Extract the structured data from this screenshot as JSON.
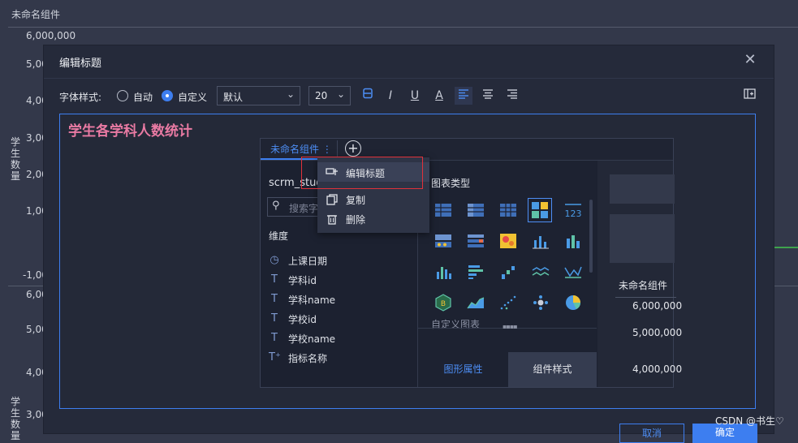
{
  "background": {
    "title": "未命名组件",
    "top_ticks": [
      "6,000,000",
      "5,00",
      "4,00",
      "3,00",
      "2,00",
      "1,00",
      "-1,00"
    ],
    "bottom_ticks": [
      "6,00",
      "5,00",
      "4,00",
      "3,00"
    ],
    "y_label_chars": [
      "学",
      "生",
      "数",
      "量"
    ]
  },
  "dialog": {
    "title": "编辑标题",
    "close_icon": "close-icon",
    "toolbar": {
      "font_style_label": "字体样式:",
      "radio_auto": "自动",
      "radio_custom": "自定义",
      "font_family_value": "默认",
      "font_size_value": "20",
      "icons": [
        "bold-icon",
        "italic-icon",
        "underline-icon",
        "font-color-icon",
        "align-left-icon",
        "align-center-icon",
        "align-right-icon",
        "insert-icon"
      ]
    },
    "heading_text": "学生各学科人数统计",
    "cancel_label": "取消",
    "confirm_label": "确定"
  },
  "inner": {
    "tab_label": "未命名组件",
    "dataset_name": "scrm_study",
    "search_placeholder": "搜索字",
    "dimension_label": "维度",
    "fields": [
      {
        "icon": "clock-icon",
        "glyph": "◷",
        "label": "上课日期"
      },
      {
        "icon": "text-type-icon",
        "glyph": "T",
        "label": "学科id"
      },
      {
        "icon": "text-type-icon",
        "glyph": "T",
        "label": "学科name"
      },
      {
        "icon": "text-type-icon",
        "glyph": "T",
        "label": "学校id"
      },
      {
        "icon": "text-type-icon",
        "glyph": "T",
        "label": "学校name"
      },
      {
        "icon": "text-type-plus-icon",
        "glyph": "T⁺",
        "label": "指标名称"
      }
    ],
    "chart_type_label": "图表类型",
    "custom_chart_label": "自定义图表",
    "tab_graphic_props": "图形属性",
    "tab_component_style": "组件样式",
    "right_title": "未命名组件",
    "right_ticks": [
      "6,000,000",
      "5,000,000",
      "4,000,000"
    ],
    "menu": [
      {
        "icon": "edit-title-icon",
        "label": "编辑标题"
      },
      {
        "icon": "copy-icon",
        "label": "复制"
      },
      {
        "icon": "delete-icon",
        "label": "删除"
      }
    ]
  },
  "watermark": "CSDN @书生♡",
  "colors": {
    "accent": "#3d7ef0",
    "heading": "#e97aa3",
    "highlight_box": "#e0313b"
  }
}
